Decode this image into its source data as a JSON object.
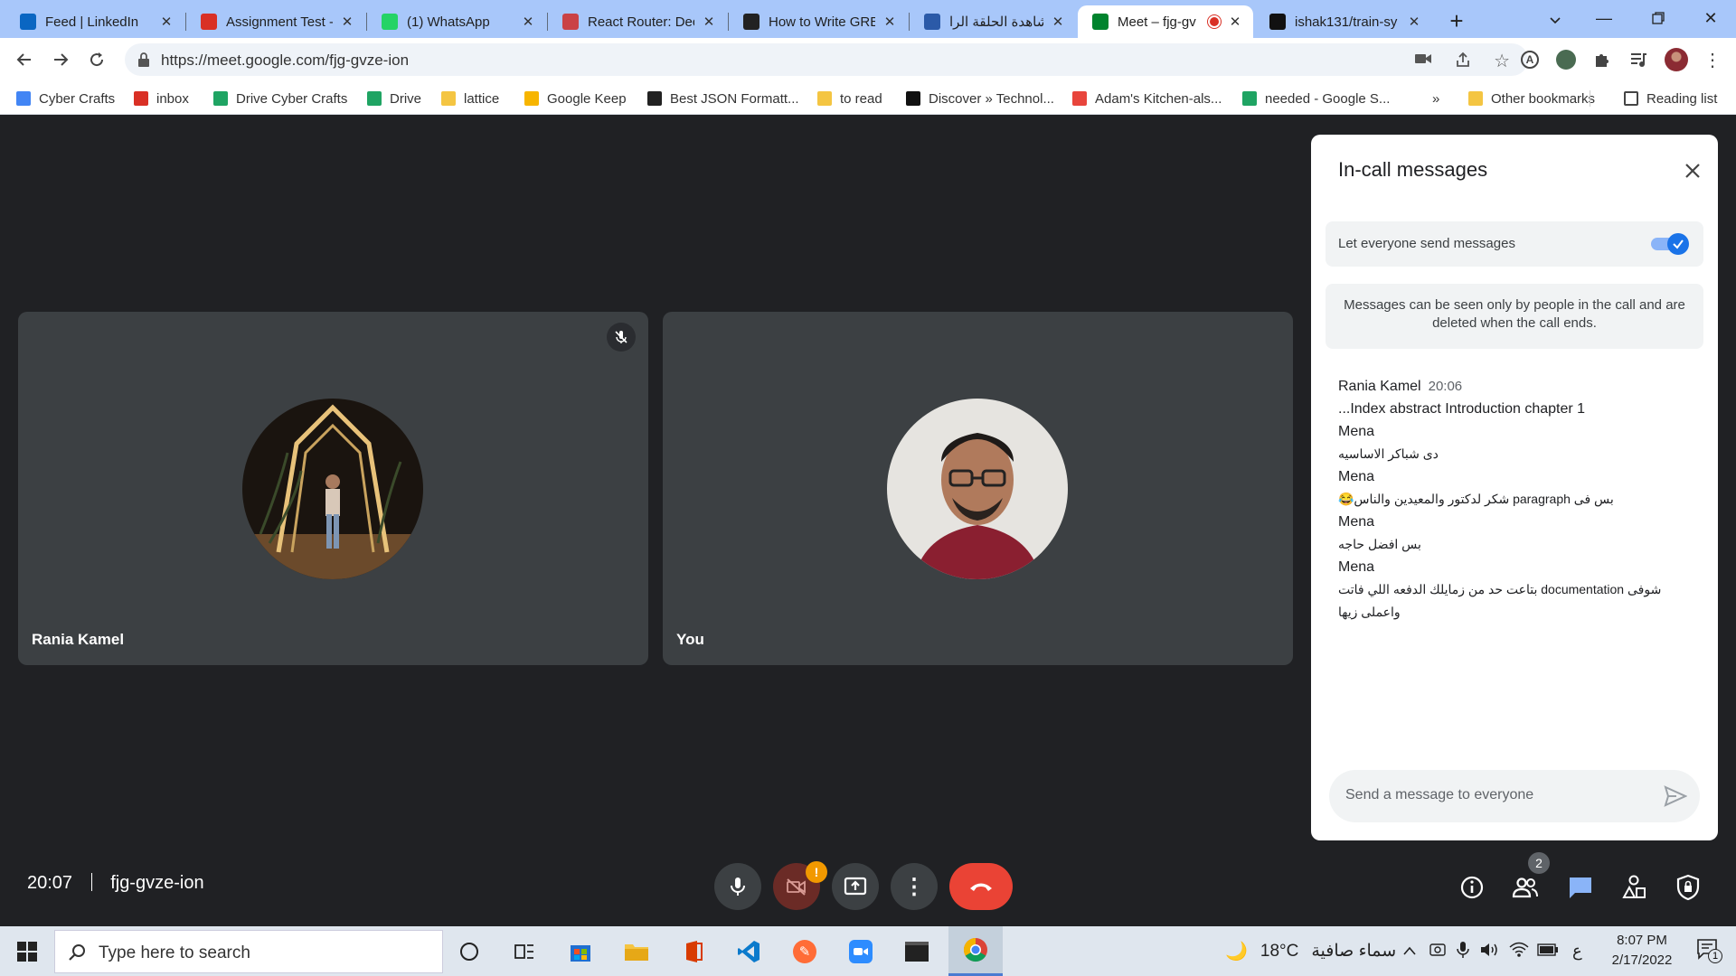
{
  "browser": {
    "tabs": [
      {
        "title": "Feed | LinkedIn",
        "icon": "linkedin-icon",
        "color": "#0a66c2"
      },
      {
        "title": "Assignment Test -",
        "icon": "gmail-icon",
        "color": "#d93025"
      },
      {
        "title": "(1) WhatsApp",
        "icon": "whatsapp-icon",
        "color": "#25d366"
      },
      {
        "title": "React Router: Dec",
        "icon": "react-router-icon",
        "color": "#ca4245"
      },
      {
        "title": "How to Write GRE",
        "icon": "tw-icon",
        "color": "#222222"
      },
      {
        "title": "مشاهدة الحلقة الرا",
        "icon": "site-icon",
        "color": "#2b5aa8"
      },
      {
        "title": "Meet – fjg-gv",
        "icon": "meet-icon",
        "color": "#00832d",
        "active": true
      },
      {
        "title": "ishak131/train-sy",
        "icon": "github-icon",
        "color": "#111111"
      }
    ],
    "url": "https://meet.google.com/fjg-gvze-ion",
    "bookmarks": [
      {
        "label": "Cyber Crafts",
        "icon": "apps-grid-icon",
        "color": "#4285f4"
      },
      {
        "label": "inbox",
        "icon": "gmail-icon",
        "color": "#d93025"
      },
      {
        "label": "Drive Cyber Crafts",
        "icon": "drive-icon",
        "color": "#1fa463"
      },
      {
        "label": "Drive",
        "icon": "drive-icon",
        "color": "#1fa463"
      },
      {
        "label": "lattice",
        "icon": "folder-icon",
        "color": "#f4c542"
      },
      {
        "label": "Google Keep",
        "icon": "keep-icon",
        "color": "#f7b500"
      },
      {
        "label": "Best JSON Formatt...",
        "icon": "jf-icon",
        "color": "#222222"
      },
      {
        "label": "to read",
        "icon": "folder-icon",
        "color": "#f4c542"
      },
      {
        "label": "Discover » Technol...",
        "icon": "discover-icon",
        "color": "#111111"
      },
      {
        "label": "Adam's Kitchen-als...",
        "icon": "chrome-icon",
        "color": "#e8453c"
      },
      {
        "label": "needed - Google S...",
        "icon": "drive-icon",
        "color": "#1fa463"
      }
    ],
    "more_bookmarks": "»",
    "other_bookmarks": "Other bookmarks",
    "reading_list": "Reading list"
  },
  "meet": {
    "participants": [
      {
        "name": "Rania Kamel",
        "muted": true
      },
      {
        "name": "You",
        "muted": false
      }
    ],
    "clock": "20:07",
    "meeting_code": "fjg-gvze-ion",
    "people_count": "2",
    "camera_alert": "!",
    "chat": {
      "title": "In-call messages",
      "toggle_label": "Let everyone send messages",
      "toggle_on": true,
      "info": "Messages can be seen only by people in the call and are deleted when the call ends.",
      "messages": [
        {
          "sender": "Rania Kamel",
          "time": "20:06",
          "text": "...Index abstract Introduction chapter 1",
          "rtl": false
        },
        {
          "sender": "Mena",
          "time": "",
          "text": "دى شباكر الاساسيه",
          "rtl": true
        },
        {
          "sender": "Mena",
          "time": "",
          "text": "بس فى paragraph شكر لدكتور والمعيدين والناس😂",
          "rtl": true
        },
        {
          "sender": "Mena",
          "time": "",
          "text": "بس افضل حاجه",
          "rtl": true
        },
        {
          "sender": "Mena",
          "time": "",
          "text": "شوفى documentation بتاعت حد من زمايلك الدفعه اللي فاتت واعملى زيها",
          "rtl": true
        }
      ],
      "input_placeholder": "Send a message to everyone"
    }
  },
  "taskbar": {
    "search_placeholder": "Type here to search",
    "weather": "18°C",
    "weather_desc": "سماء صافية",
    "lang": "ع",
    "time": "8:07 PM",
    "date": "2/17/2022",
    "notification_count": "1"
  }
}
